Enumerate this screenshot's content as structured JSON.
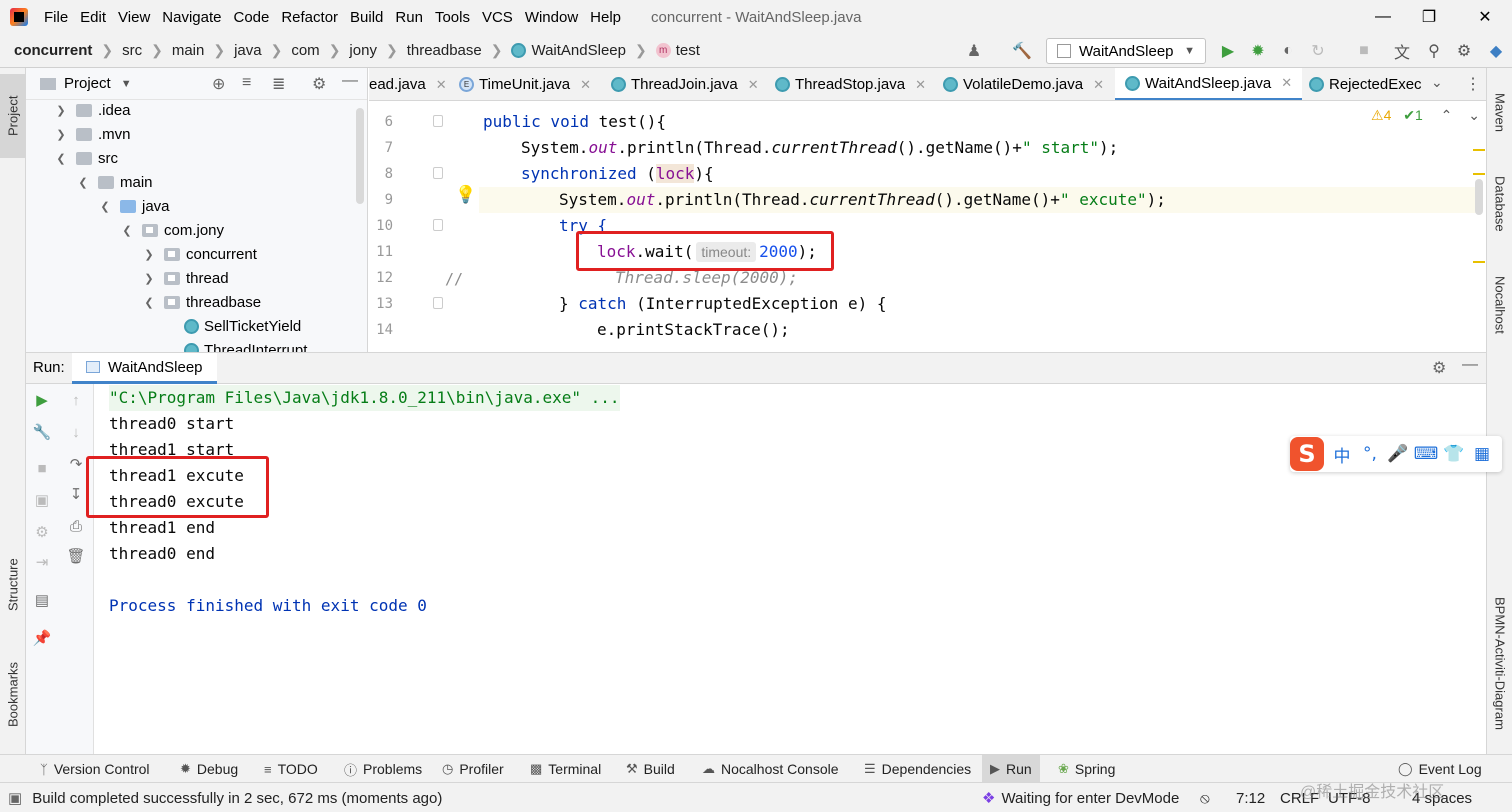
{
  "window": {
    "title": "concurrent - WaitAndSleep.java",
    "menu": [
      "File",
      "Edit",
      "View",
      "Navigate",
      "Code",
      "Refactor",
      "Build",
      "Run",
      "Tools",
      "VCS",
      "Window",
      "Help"
    ]
  },
  "breadcrumb": [
    "concurrent",
    "src",
    "main",
    "java",
    "com",
    "jony",
    "threadbase",
    "WaitAndSleep",
    "test"
  ],
  "toolbar": {
    "run_config": "WaitAndSleep"
  },
  "project": {
    "title": "Project",
    "tree": [
      {
        "label": ".idea"
      },
      {
        "label": ".mvn"
      },
      {
        "label": "src"
      },
      {
        "label": "main"
      },
      {
        "label": "java"
      },
      {
        "label": "com.jony"
      },
      {
        "label": "concurrent"
      },
      {
        "label": "thread"
      },
      {
        "label": "threadbase"
      },
      {
        "label": "SellTicketYield"
      },
      {
        "label": "ThreadInterrupt"
      }
    ]
  },
  "editor": {
    "tabs": [
      "ead.java",
      "TimeUnit.java",
      "ThreadJoin.java",
      "ThreadStop.java",
      "VolatileDemo.java",
      "WaitAndSleep.java",
      "RejectedExec"
    ],
    "active_tab": "WaitAndSleep.java",
    "inspections": {
      "warnings": "4",
      "ok": "1"
    },
    "line_numbers": [
      "6",
      "7",
      "8",
      "9",
      "10",
      "11",
      "12",
      "13",
      "14"
    ],
    "hint_label": "timeout:",
    "comment_marker": "//",
    "code": {
      "l6_kw": "public void ",
      "l6_rest": "test(){",
      "l7_a": "System.",
      "l7_out": "out",
      "l7_b": ".println(Thread.",
      "l7_ct": "currentThread",
      "l7_c": "().getName()+",
      "l7_s": "\" start\"",
      "l7_d": ");",
      "l8_kw": "synchronized ",
      "l8_a": "(",
      "l8_lock": "lock",
      "l8_b": "){",
      "l9_a": "System.",
      "l9_out": "out",
      "l9_b": ".println(Thread.",
      "l9_ct": "currentThread",
      "l9_c": "().getName()+",
      "l9_s": "\" excute\"",
      "l9_d": ");",
      "l10": "try {",
      "l11_lock": "lock",
      "l11_a": ".wait(",
      "l11_num": "2000",
      "l11_b": ");",
      "l12": "Thread.sleep(2000);",
      "l13_a": "} ",
      "l13_kw": "catch ",
      "l13_b": "(InterruptedException e) {",
      "l14": "e.printStackTrace();"
    }
  },
  "run": {
    "label": "Run:",
    "tab": "WaitAndSleep",
    "output": [
      "\"C:\\Program Files\\Java\\jdk1.8.0_211\\bin\\java.exe\" ...",
      "thread0 start",
      "thread1 start",
      "thread1 excute",
      "thread0 excute",
      "thread1 end",
      "thread0 end",
      "",
      "Process finished with exit code 0"
    ]
  },
  "left_strip": [
    "Project",
    "Structure",
    "Bookmarks"
  ],
  "right_strip": [
    "Maven",
    "Database",
    "Nocalhost",
    "BPMN-Activiti-Diagram"
  ],
  "bottom_tools": [
    "Version Control",
    "Debug",
    "TODO",
    "Problems",
    "Profiler",
    "Terminal",
    "Build",
    "Nocalhost Console",
    "Dependencies",
    "Run",
    "Spring",
    "Event Log"
  ],
  "status": {
    "message": "Build completed successfully in 2 sec, 672 ms (moments ago)",
    "devmode": "Waiting for enter DevMode",
    "position": "7:12",
    "line_sep": "CRLF",
    "encoding": "UTF-8",
    "indent": "4 spaces",
    "watermark": "@稀土掘金技术社区"
  },
  "ime": {
    "items": [
      "中",
      "°,",
      "🎤",
      "⌨",
      "👕",
      "▦"
    ]
  }
}
